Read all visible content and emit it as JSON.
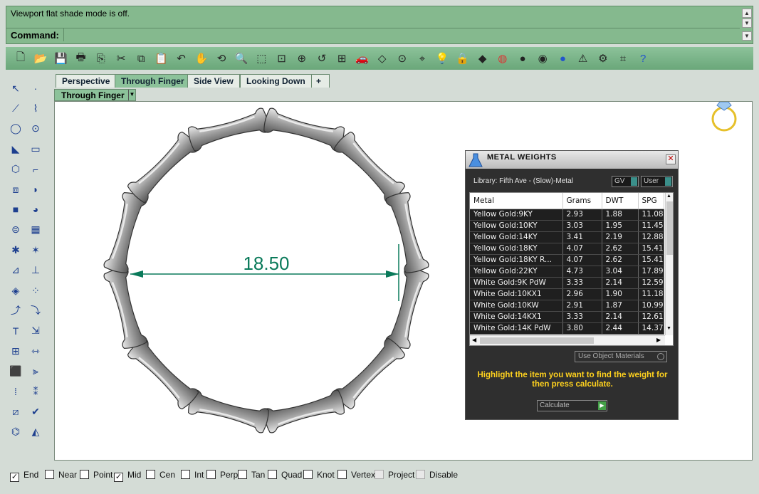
{
  "command": {
    "history_line": "Viewport flat shade mode is off.",
    "prompt_label": "Command:",
    "input_value": ""
  },
  "toolbar": {
    "icons": [
      "new-file-icon",
      "open-folder-icon",
      "save-icon",
      "print-icon",
      "import-icon",
      "cut-icon",
      "copy-icon",
      "paste-icon",
      "undo-icon",
      "pan-hand-icon",
      "rotate-view-icon",
      "zoom-dynamic-icon",
      "zoom-window-icon",
      "zoom-extents-icon",
      "zoom-selected-icon",
      "undo-view-icon",
      "four-viewports-icon",
      "car-icon",
      "display-mode-icon",
      "hide-icon",
      "show-icon",
      "light-bulb-icon",
      "lock-icon",
      "layers-icon",
      "color-wheel-icon",
      "render-sphere-icon",
      "material-sphere-icon",
      "blue-sphere-icon",
      "render-icon",
      "options-gear-icon",
      "snap-icon",
      "help-icon"
    ]
  },
  "left_toolbar": {
    "icons": [
      "select-arrow-icon",
      "point-icon",
      "polyline-icon",
      "control-curve-icon",
      "circle-icon",
      "ellipse-icon",
      "arc-icon",
      "rectangle-icon",
      "polygon-icon",
      "fillet-curve-icon",
      "surface-icon",
      "loft-icon",
      "box-solid-icon",
      "sphere-solid-icon",
      "cylinder-icon",
      "mesh-icon",
      "gear-component-icon",
      "explode-icon",
      "trim-icon",
      "split-icon",
      "boolean-icon",
      "group-icon",
      "curve-from-surface-icon",
      "offset-curve-icon",
      "text-icon",
      "scale-icon",
      "array-icon",
      "mirror-icon",
      "solid-edit-icon",
      "dimension-icon",
      "grid-array-icon",
      "lamp-icon",
      "flow-along-icon",
      "check-icon",
      "analyze-icon",
      "paint-bucket-icon"
    ]
  },
  "tabs": [
    "Perspective",
    "Through Finger",
    "Side View",
    "Looking Down"
  ],
  "active_tab": "Through Finger",
  "viewport": {
    "title": "Through Finger",
    "dimension_value": "18.50",
    "dimension_color": "#0a7a5a"
  },
  "metal_weights": {
    "title": "METAL WEIGHTS",
    "library_label": "Library: Fifth Ave - (Slow)-Metal",
    "unit_select": "GV",
    "user_select": "User",
    "columns": [
      "Metal",
      "Grams",
      "DWT",
      "SPG"
    ],
    "rows": [
      [
        "Yellow Gold:9KY",
        "2.93",
        "1.88",
        "11.08"
      ],
      [
        "Yellow Gold:10KY",
        "3.03",
        "1.95",
        "11.45"
      ],
      [
        "Yellow Gold:14KY",
        "3.41",
        "2.19",
        "12.88"
      ],
      [
        "Yellow Gold:18KY",
        "4.07",
        "2.62",
        "15.41"
      ],
      [
        "Yellow Gold:18KY R...",
        "4.07",
        "2.62",
        "15.41"
      ],
      [
        "Yellow Gold:22KY",
        "4.73",
        "3.04",
        "17.89"
      ],
      [
        "White Gold:9K PdW",
        "3.33",
        "2.14",
        "12.59"
      ],
      [
        "White Gold:10KX1",
        "2.96",
        "1.90",
        "11.18"
      ],
      [
        "White Gold:10KW",
        "2.91",
        "1.87",
        "10.99"
      ],
      [
        "White Gold:14KX1",
        "3.33",
        "2.14",
        "12.61"
      ],
      [
        "White Gold:14K PdW",
        "3.80",
        "2.44",
        "14.37"
      ]
    ],
    "use_object_materials": "Use Object Materials",
    "message": "Highlight the item you want to find the weight for then press calculate.",
    "calculate_label": "Calculate"
  },
  "osnaps": [
    {
      "label": "End",
      "checked": true,
      "disabled": false
    },
    {
      "label": "Near",
      "checked": false,
      "disabled": false
    },
    {
      "label": "Point",
      "checked": false,
      "disabled": false
    },
    {
      "label": "Mid",
      "checked": true,
      "disabled": false
    },
    {
      "label": "Cen",
      "checked": false,
      "disabled": false
    },
    {
      "label": "Int",
      "checked": false,
      "disabled": false
    },
    {
      "label": "Perp",
      "checked": false,
      "disabled": false
    },
    {
      "label": "Tan",
      "checked": false,
      "disabled": false
    },
    {
      "label": "Quad",
      "checked": false,
      "disabled": false
    },
    {
      "label": "Knot",
      "checked": false,
      "disabled": false
    },
    {
      "label": "Vertex",
      "checked": false,
      "disabled": false
    },
    {
      "label": "Project",
      "checked": false,
      "disabled": true
    },
    {
      "label": "Disable",
      "checked": false,
      "disabled": true
    }
  ]
}
